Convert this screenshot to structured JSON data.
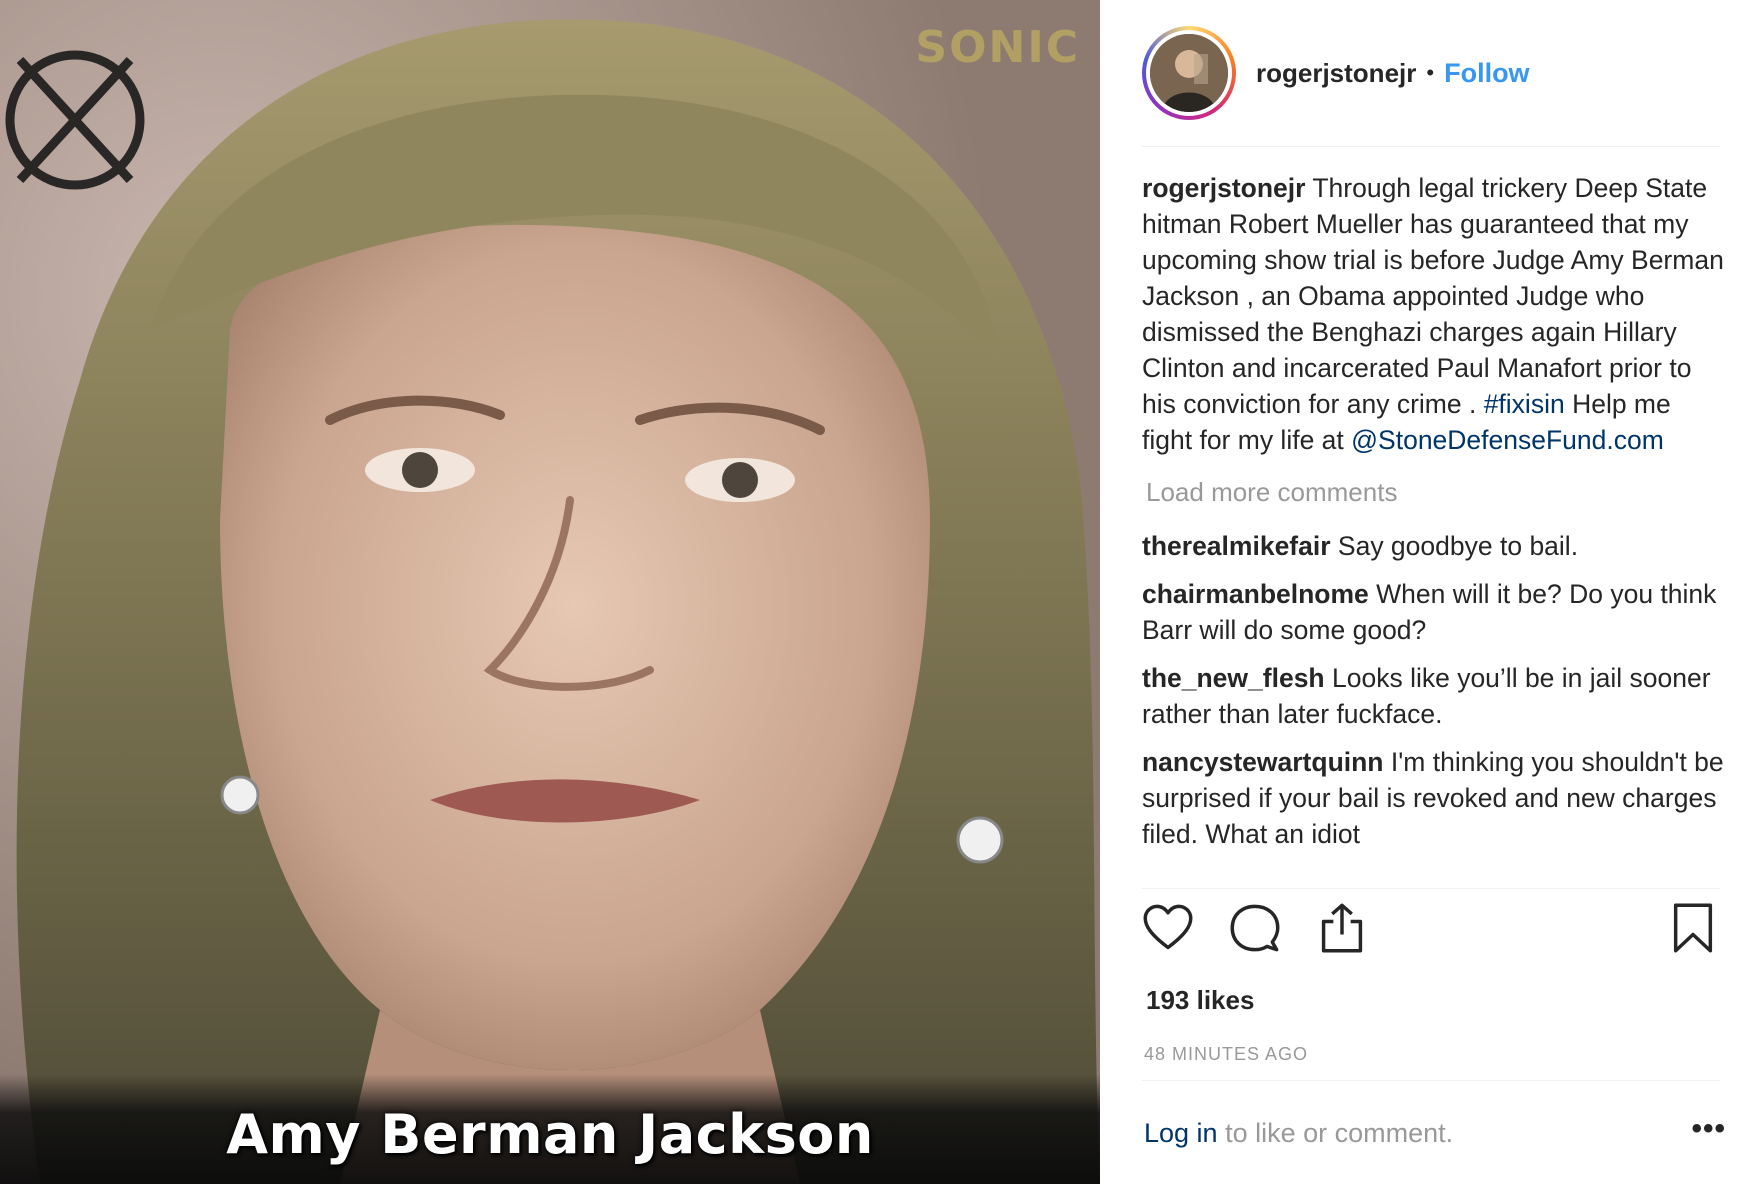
{
  "photo": {
    "caption": "Amy Berman Jackson",
    "watermark": "SONIC"
  },
  "post": {
    "header": {
      "username": "rogerjstonejr",
      "separator": "•",
      "follow_label": "Follow"
    },
    "caption": {
      "username": "rogerjstonejr",
      "text_before_hashtag": " Through legal trickery Deep State hitman Robert Mueller has guaranteed that my upcoming show trial is before Judge Amy Berman Jackson , an Obama appointed Judge who dismissed the Benghazi charges again Hillary Clinton and incarcerated Paul Manafort prior to his conviction for any crime . ",
      "hashtag": "#fixisin",
      "text_after_hashtag": " Help me fight for my life at ",
      "mention": "@StoneDefenseFund.com"
    },
    "load_more_label": "Load more comments",
    "comments": [
      {
        "username": "therealmikefair",
        "text": " Say goodbye to bail."
      },
      {
        "username": "chairmanbelnome",
        "text": " When will it be? Do you think Barr will do some good?"
      },
      {
        "username": "the_new_flesh",
        "text": " Looks like you’ll be in jail sooner rather than later fuckface."
      },
      {
        "username": "nancystewartquinn",
        "text": " I'm thinking you shouldn't be surprised if your bail is revoked and new charges filed. What an idiot"
      }
    ],
    "likes": "193 likes",
    "timestamp": "48 MINUTES AGO",
    "login_link": "Log in",
    "login_rest": " to like or comment.",
    "more_label": "•••"
  },
  "icons": {
    "like": "heart-icon",
    "comment": "comment-bubble-icon",
    "share": "share-upload-icon",
    "save": "bookmark-icon",
    "more": "more-options-icon"
  },
  "colors": {
    "follow_blue": "#3897f0",
    "link_navy": "#003569",
    "muted_gray": "#999999",
    "text": "#262626"
  }
}
